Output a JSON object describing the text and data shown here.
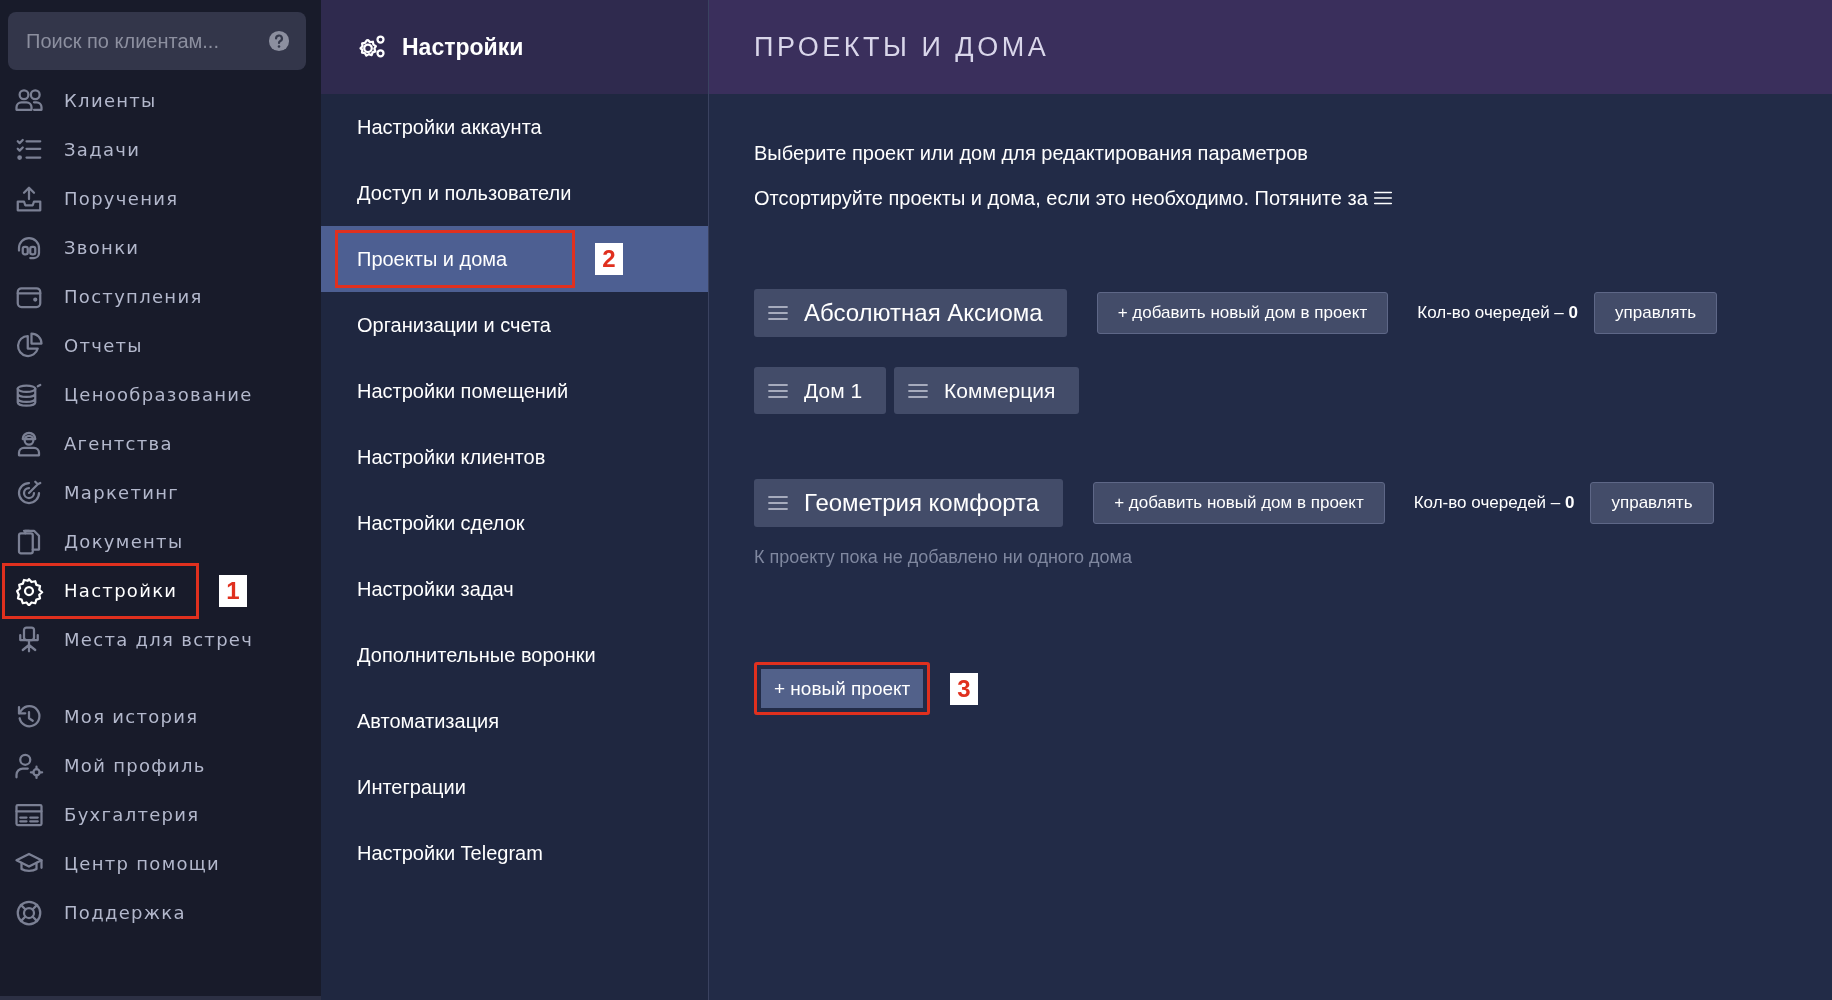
{
  "sidebar": {
    "search": {
      "placeholder": "Поиск по клиентам..."
    },
    "items": [
      {
        "label": "Клиенты",
        "selected": false
      },
      {
        "label": "Задачи",
        "selected": false
      },
      {
        "label": "Поручения",
        "selected": false
      },
      {
        "label": "Звонки",
        "selected": false
      },
      {
        "label": "Поступления",
        "selected": false
      },
      {
        "label": "Отчеты",
        "selected": false
      },
      {
        "label": "Ценообразование",
        "selected": false
      },
      {
        "label": "Агентства",
        "selected": false
      },
      {
        "label": "Маркетинг",
        "selected": false
      },
      {
        "label": "Документы",
        "selected": false
      },
      {
        "label": "Настройки",
        "selected": true,
        "callout": "1"
      },
      {
        "label": "Места для встреч",
        "selected": false
      }
    ],
    "secondary_items": [
      {
        "label": "Моя история",
        "selected": false
      },
      {
        "label": "Мой профиль",
        "selected": false
      },
      {
        "label": "Бухгалтерия",
        "selected": false
      },
      {
        "label": "Центр помощи",
        "selected": false
      },
      {
        "label": "Поддержка",
        "selected": false
      }
    ]
  },
  "settings_menu": {
    "title": "Настройки",
    "items": [
      {
        "label": "Настройки аккаунта",
        "selected": false
      },
      {
        "label": "Доступ и пользователи",
        "selected": false
      },
      {
        "label": "Проекты и дома",
        "selected": true,
        "callout": "2"
      },
      {
        "label": "Организации и счета",
        "selected": false
      },
      {
        "label": "Настройки помещений",
        "selected": false
      },
      {
        "label": "Настройки клиентов",
        "selected": false
      },
      {
        "label": "Настройки сделок",
        "selected": false
      },
      {
        "label": "Настройки задач",
        "selected": false
      },
      {
        "label": "Дополнительные воронки",
        "selected": false
      },
      {
        "label": "Автоматизация",
        "selected": false
      },
      {
        "label": "Интеграции",
        "selected": false
      },
      {
        "label": "Настройки Telegram",
        "selected": false
      }
    ]
  },
  "main": {
    "title": "ПРОЕКТЫ И ДОМА",
    "intro": "Выберите проект или дом для редактирования параметров",
    "sort_hint": "Отсортируйте проекты и дома, если это необходимо. Потяните за",
    "projects": [
      {
        "name": "Абсолютная Аксиома",
        "add_button": "+ добавить новый дом в проект",
        "queues": "Кол-во очередей – **0**",
        "manage_button": "управлять",
        "houses": [
          "Дом 1",
          "Коммерция"
        ]
      },
      {
        "name": "Геометрия комфорта",
        "add_button": "+ добавить новый дом в проект",
        "queues": "Кол-во очередей – **0**",
        "manage_button": "управлять",
        "empty_note": "К проекту пока не добавлено ни одного дома"
      }
    ],
    "new_project_button": {
      "label": "+ новый проект",
      "callout": "3"
    }
  }
}
